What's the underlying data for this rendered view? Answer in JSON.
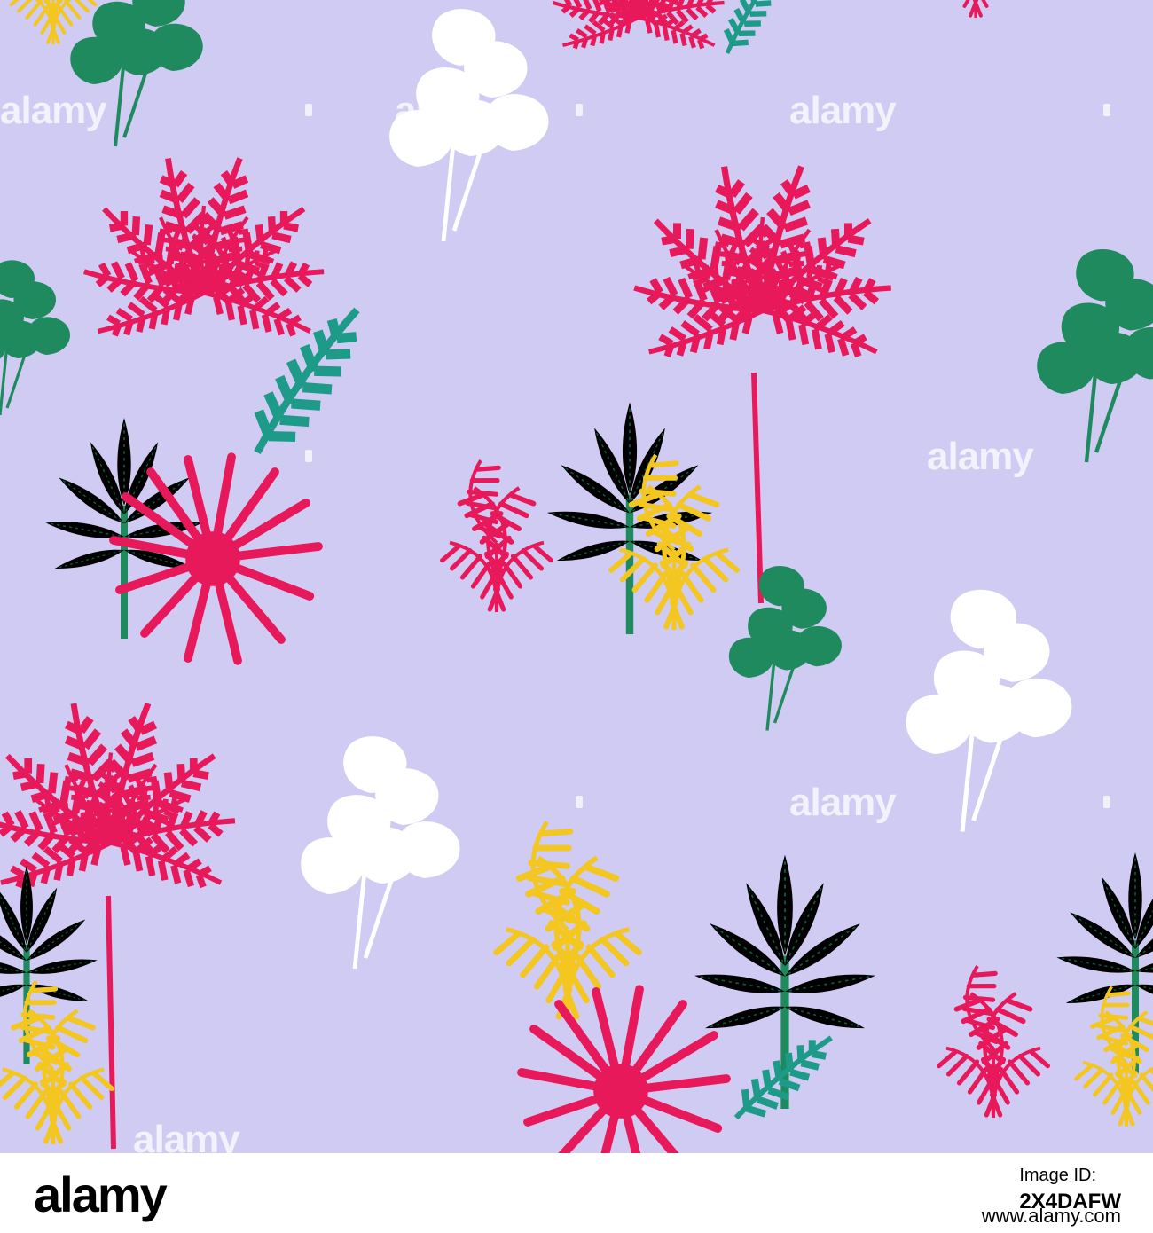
{
  "watermark": "alamy",
  "footer": {
    "logo": "alamy",
    "image_id_label": "Image ID:",
    "image_id": "2X4DAFW",
    "url": "www.alamy.com"
  },
  "palette": {
    "background": "#cfcbf2",
    "pink": "#e8195a",
    "green": "#1f8a5e",
    "teal": "#1d9a88",
    "yellow": "#f3c620",
    "white": "#ffffff",
    "dark_red": "#8a1020"
  }
}
